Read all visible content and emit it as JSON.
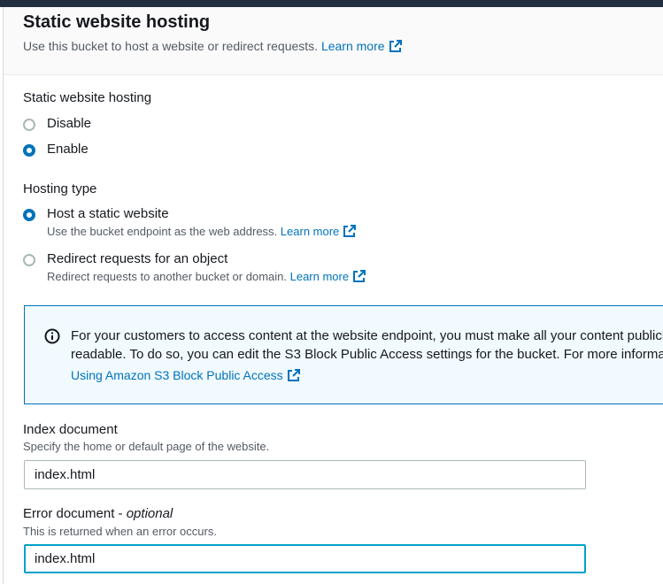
{
  "header": {
    "title": "Static website hosting",
    "subtitle": "Use this bucket to host a website or redirect requests.",
    "learn_more": "Learn more"
  },
  "hosting": {
    "label": "Static website hosting",
    "options": [
      {
        "label": "Disable",
        "checked": false
      },
      {
        "label": "Enable",
        "checked": true
      }
    ]
  },
  "hosting_type": {
    "label": "Hosting type",
    "options": [
      {
        "label": "Host a static website",
        "description": "Use the bucket endpoint as the web address.",
        "learn_more": "Learn more",
        "checked": true
      },
      {
        "label": "Redirect requests for an object",
        "description": "Redirect requests to another bucket or domain.",
        "learn_more": "Learn more",
        "checked": false
      }
    ]
  },
  "alert": {
    "line1": "For your customers to access content at the website endpoint, you must make all your content publicly",
    "line2": "readable. To do so, you can edit the S3 Block Public Access settings for the bucket. For more information, see",
    "link": "Using Amazon S3 Block Public Access"
  },
  "index_document": {
    "label": "Index document",
    "description": "Specify the home or default page of the website.",
    "value": "index.html"
  },
  "error_document": {
    "label": "Error document",
    "label_suffix": "optional",
    "description": "This is returned when an error occurs.",
    "value": "index.html"
  },
  "colors": {
    "link": "#0073bb",
    "topbar": "#232f3e",
    "focus": "#00a1c9",
    "alert_bg": "#f1faff"
  },
  "icons": [
    "external-link-icon",
    "info-icon"
  ]
}
